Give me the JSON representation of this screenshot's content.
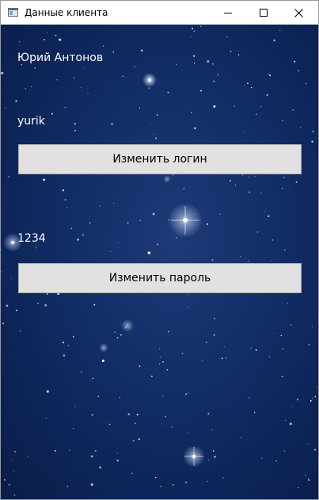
{
  "window": {
    "title": "Данные клиента",
    "icon": "app-window-icon"
  },
  "controls": {
    "minimize_icon": "minimize-icon",
    "maximize_icon": "maximize-icon",
    "close_icon": "close-icon"
  },
  "client": {
    "full_name": "Юрий Антонов",
    "login": "yurik",
    "change_login_label": "Изменить логин",
    "password": "1234",
    "change_password_label": "Изменить пароль"
  },
  "colors": {
    "background_space": "#14306a",
    "button_bg": "#e1e1e1",
    "button_border": "#adadad",
    "text_light": "#ffffff"
  }
}
